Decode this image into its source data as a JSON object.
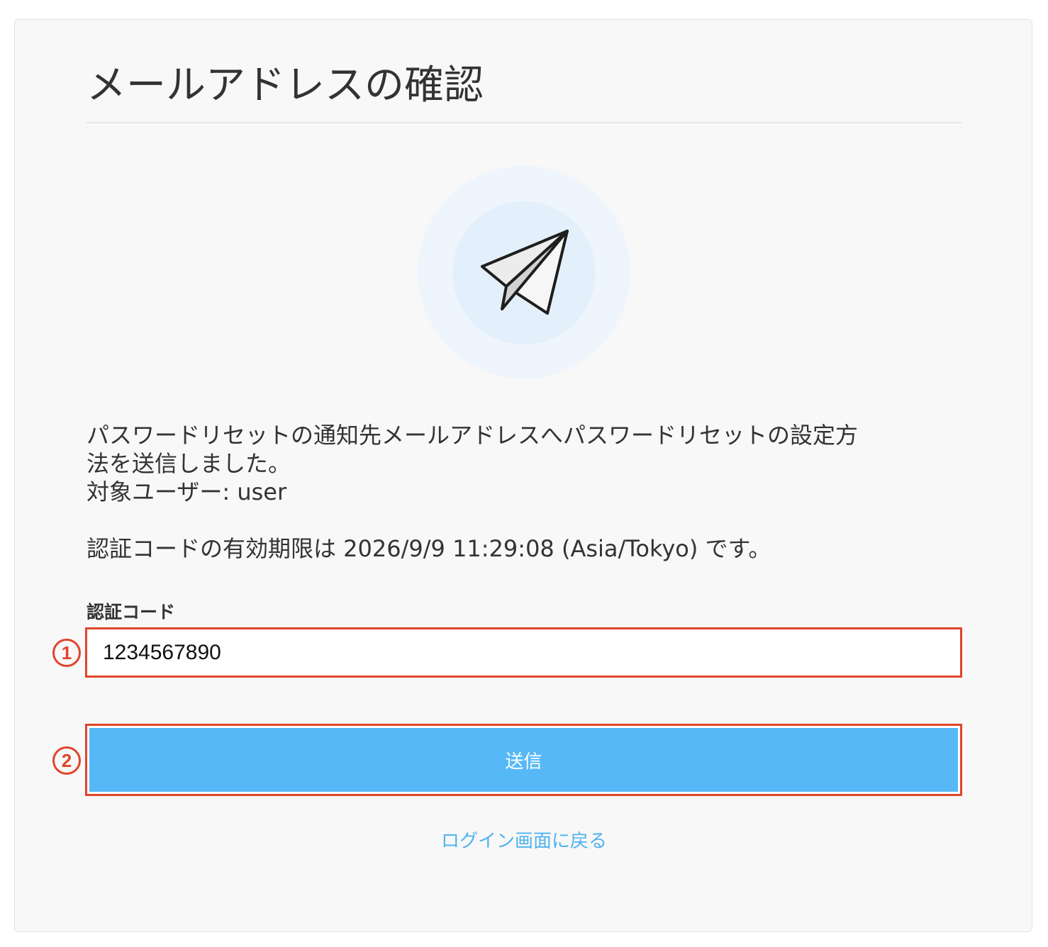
{
  "page": {
    "title": "メールアドレスの確認"
  },
  "icon": {
    "name": "paper-plane-icon"
  },
  "message": {
    "line1": "パスワードリセットの通知先メールアドレスへパスワードリセットの設定方",
    "line2": "法を送信しました。",
    "target_user": "対象ユーザー: user",
    "expiry": "認証コードの有効期限は 2026/9/9 11:29:08 (Asia/Tokyo) です。"
  },
  "form": {
    "code_label": "認証コード",
    "code_value": "1234567890",
    "submit_label": "送信"
  },
  "annotations": {
    "marker1": "1",
    "marker2": "2"
  },
  "links": {
    "back_to_login": "ログイン画面に戻る"
  },
  "colors": {
    "primary_button": "#56b8f7",
    "link": "#4fb3ee",
    "annotation": "#e0452b"
  }
}
